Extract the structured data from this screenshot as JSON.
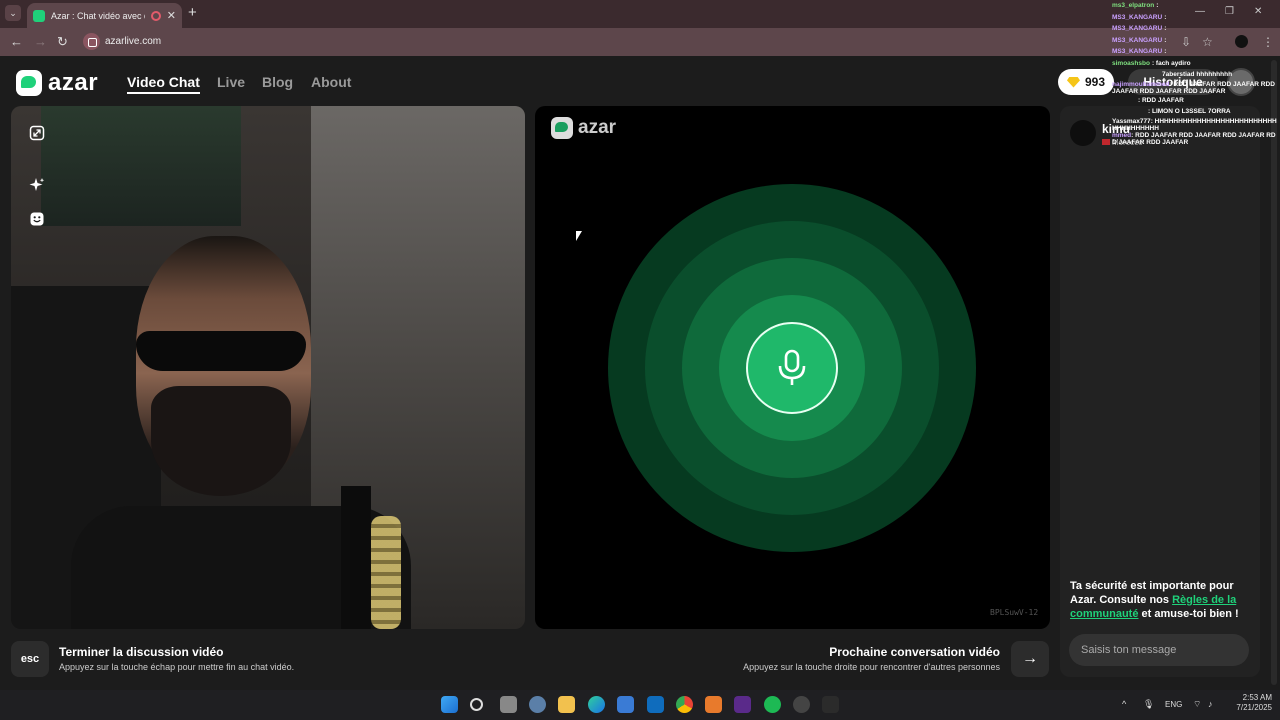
{
  "browser": {
    "tab_title": "Azar : Chat vidéo avec de n",
    "url": "azarlive.com",
    "new_tab": "+",
    "tab_close": "✕",
    "window_controls": [
      "—",
      "❐",
      "✕"
    ]
  },
  "header": {
    "logo_text": "azar",
    "nav": [
      "Video Chat",
      "Live",
      "Blog",
      "About"
    ],
    "gems": "993",
    "history_label": "Historique"
  },
  "center": {
    "logo_text": "azar",
    "session_code": "BPLSuwV-12"
  },
  "chat": {
    "partner_name": "kimu",
    "partner_country": "Morocco",
    "safety_pre": "Ta sécurité est importante pour Azar. Consulte nos ",
    "safety_link": "Règles de la communauté",
    "safety_post": " et amuse-toi bien !",
    "input_placeholder": "Saisis ton message"
  },
  "bottom": {
    "esc_key": "esc",
    "end_title": "Terminer la discussion vidéo",
    "end_sub": "Appuyez sur la touche échap pour mettre fin au chat vidéo.",
    "next_title": "Prochaine conversation vidéo",
    "next_sub": "Appuyez sur la touche droite pour rencontrer d'autres personnes",
    "next_arrow": "→"
  },
  "stream_chat": [
    {
      "user": "ms3_elpatron",
      "color": "#7fe07f",
      "text": ":"
    },
    {
      "user": "MS3_KANGARU",
      "color": "#c9a0ff",
      "text": ":"
    },
    {
      "user": "MS3_KANGARU",
      "color": "#c9a0ff",
      "text": ":"
    },
    {
      "user": "MS3_KANGARU",
      "color": "#c9a0ff",
      "text": ":"
    },
    {
      "user": "MS3_KANGARU",
      "color": "#c9a0ff",
      "text": ":"
    },
    {
      "user": "simoashsbo",
      "color": "#7fe07f",
      "text": ": fach aydiro"
    },
    {
      "user": "",
      "color": "#ffffff",
      "text": "7aberstiad hhhhhhhhh"
    },
    {
      "user": "najimmouhammed",
      "color": "#c9a0ff",
      "text": ": RDD JAAFAR RDD JAAFAR RDD JAAFAR RDD JAAFAR RDD JAAFAR"
    },
    {
      "user": "",
      "color": "#ff6b8a",
      "text": ": RDD JAAFAR"
    },
    {
      "user": "",
      "color": "#7fe07f",
      "text": ": LIMON O L3SSEL 7ORRA"
    },
    {
      "user": "Yassmax777",
      "color": "#ffffff",
      "text": ": HHHHHHHHHHHHHHHHHHHHHHHHHHHHHHHHHHHH"
    },
    {
      "user": "mmed",
      "color": "#c9a0ff",
      "text": ": RDD JAAFAR RDD JAAFAR RDD JAAFAR RDD JAAFAR RDD JAAFAR"
    }
  ],
  "taskbar": {
    "language": "ENG",
    "time": "2:53 AM",
    "date": "7/21/2025",
    "chevron": "^"
  },
  "colors": {
    "accent": "#1fd17a",
    "ring1": "#063a20",
    "ring2": "#0a4e2c",
    "ring3": "#0f6a3b",
    "ring4": "#158a4d",
    "mic": "#1fb86a"
  }
}
